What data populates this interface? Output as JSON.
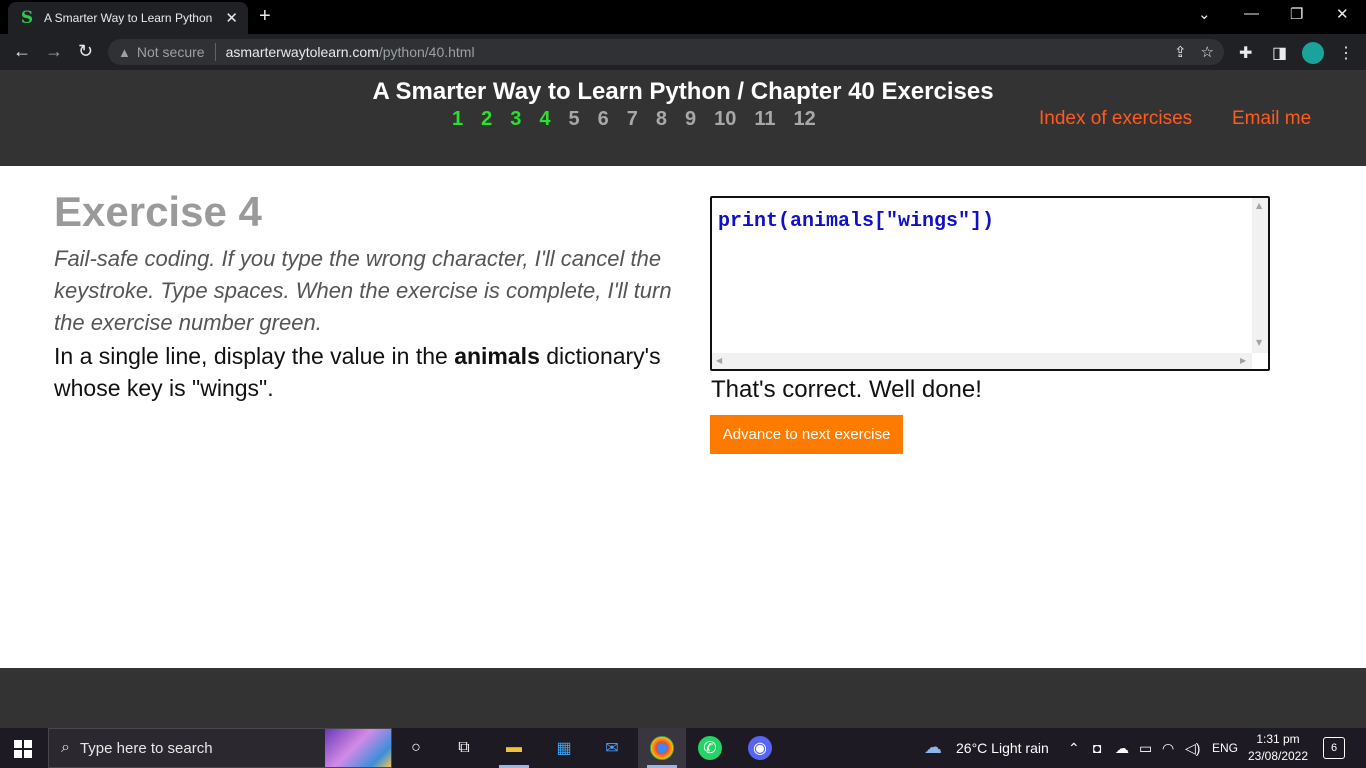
{
  "browser": {
    "tab_title": "A Smarter Way to Learn Python -",
    "tab_favicon": "S",
    "new_tab": "+",
    "security_label": "Not secure",
    "url_host": "asmarterwaytolearn.com",
    "url_path": "/python/40.html",
    "window_controls": [
      "⌄",
      "—",
      "❐",
      "✕"
    ]
  },
  "header": {
    "title": "A Smarter Way to Learn Python / Chapter 40 Exercises",
    "exercises": [
      {
        "label": "1",
        "done": true
      },
      {
        "label": "2",
        "done": true
      },
      {
        "label": "3",
        "done": true
      },
      {
        "label": "4",
        "done": true
      },
      {
        "label": "5",
        "done": false
      },
      {
        "label": "6",
        "done": false
      },
      {
        "label": "7",
        "done": false
      },
      {
        "label": "8",
        "done": false
      },
      {
        "label": "9",
        "done": false
      },
      {
        "label": "10",
        "done": false
      },
      {
        "label": "11",
        "done": false
      },
      {
        "label": "12",
        "done": false
      }
    ],
    "index_link": "Index of exercises",
    "email_link": "Email me",
    "done_color": "#2ee02e",
    "link_color": "#ff5b1f"
  },
  "exercise": {
    "title": "Exercise 4",
    "instructions": "Fail-safe coding. If you type the wrong character, I'll cancel the keystroke. Type spaces. When the exercise is complete, I'll turn the exercise number green.",
    "task_pre": "In a single line, display the value in the ",
    "task_bold": "animals",
    "task_post": " dictionary's whose key is \"wings\".",
    "code": "print(animals[\"wings\"])",
    "result": "That's correct. Well done!",
    "advance_button": "Advance to next exercise",
    "accent_color": "#ff7b00"
  },
  "taskbar": {
    "search_placeholder": "Type here to search",
    "weather": "26°C  Light rain",
    "language": "ENG",
    "time": "1:31 pm",
    "date": "23/08/2022",
    "notification_count": "6"
  }
}
